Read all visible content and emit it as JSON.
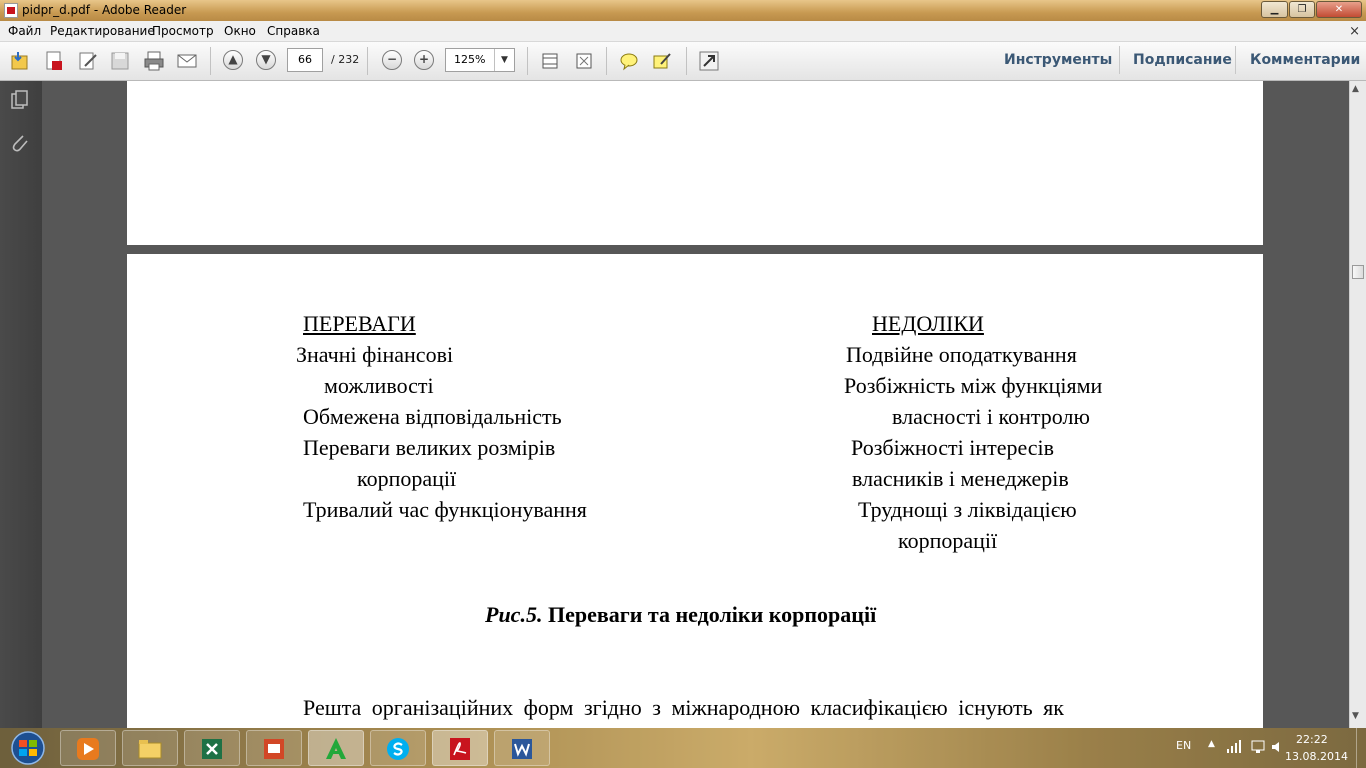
{
  "window": {
    "title": "pidpr_d.pdf - Adobe Reader"
  },
  "menu": {
    "items": [
      "Файл",
      "Редактирование",
      "Просмотр",
      "Окно",
      "Справка"
    ],
    "close_glyph": "×"
  },
  "toolbar": {
    "page_current": "66",
    "page_total": "/ 232",
    "zoom": "125%",
    "zoom_out_glyph": "−",
    "zoom_in_glyph": "+",
    "right_buttons": [
      "Инструменты",
      "Подписание",
      "Комментарии"
    ]
  },
  "document": {
    "advantages_header": "ПЕРЕВАГИ",
    "disadvantages_header": "НЕДОЛІКИ",
    "advantages": [
      "Значні фінансові",
      "можливості",
      "Обмежена відповідальність",
      "Переваги великих розмірів",
      "корпорації",
      "Тривалий час функціонування"
    ],
    "disadvantages": [
      "Подвійне оподаткування",
      "Розбіжність між функціями",
      "власності і контролю",
      "Розбіжності інтересів",
      "власників і менеджерів",
      "Труднощі з ліквідацією",
      "корпорації"
    ],
    "caption_prefix": "Рис.5.",
    "caption_text": "Переваги та недоліки корпорації",
    "paragraph": "Решта організаційних форм згідно з міжнародною класифікацією існують як"
  },
  "taskbar": {
    "apps": [
      "media-player",
      "file-explorer",
      "excel",
      "presentation",
      "green-a",
      "skype",
      "adobe-reader",
      "word"
    ],
    "language": "EN",
    "time": "22:22",
    "date": "13.08.2014"
  },
  "colors": {
    "accent_text": "#3b5875",
    "pdf_red": "#c8141e"
  }
}
